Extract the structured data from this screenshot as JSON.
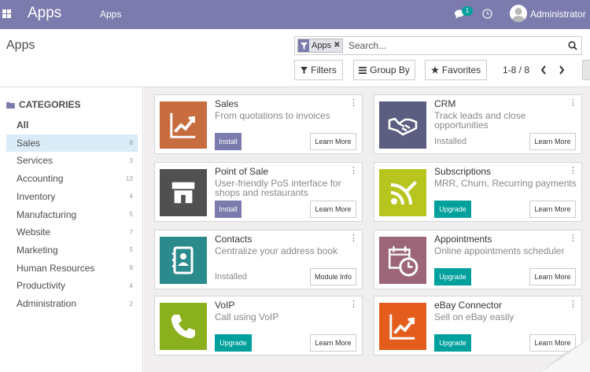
{
  "navbar": {
    "brand": "Apps",
    "menu": "Apps",
    "chat_badge": "1",
    "user": "Administrator",
    "bg_color": "#7c7bad"
  },
  "control": {
    "breadcrumb": "Apps",
    "facet_label": "Apps",
    "facet_close": "✖",
    "search_placeholder": "Search...",
    "filters_label": "Filters",
    "groupby_label": "Group By",
    "favorites_label": "Favorites",
    "pager": "1-8 / 8"
  },
  "sidebar": {
    "title": "CATEGORIES",
    "items": [
      {
        "label": "All",
        "count": ""
      },
      {
        "label": "Sales",
        "count": "8"
      },
      {
        "label": "Services",
        "count": "3"
      },
      {
        "label": "Accounting",
        "count": "13"
      },
      {
        "label": "Inventory",
        "count": "4"
      },
      {
        "label": "Manufacturing",
        "count": "5"
      },
      {
        "label": "Website",
        "count": "7"
      },
      {
        "label": "Marketing",
        "count": "5"
      },
      {
        "label": "Human Resources",
        "count": "9"
      },
      {
        "label": "Productivity",
        "count": "4"
      },
      {
        "label": "Administration",
        "count": "2"
      }
    ]
  },
  "apps": [
    {
      "name": "Sales",
      "desc": "From quotations to invoices",
      "action": "Install",
      "secondary": "Learn More",
      "color": "#c76c3e",
      "icon": "chart-up-icon"
    },
    {
      "name": "CRM",
      "desc": "Track leads and close opportunities",
      "action": "Installed",
      "secondary": "Learn More",
      "color": "#5b5e80",
      "icon": "handshake-icon"
    },
    {
      "name": "Point of Sale",
      "desc": "User-friendly PoS interface for shops and restaurants",
      "action": "Install",
      "secondary": "Learn More",
      "color": "#505050",
      "icon": "store-icon"
    },
    {
      "name": "Subscriptions",
      "desc": "MRR, Churn, Recurring payments",
      "action": "Upgrade",
      "secondary": "Learn More",
      "color": "#b7c51e",
      "icon": "rss-pen-icon"
    },
    {
      "name": "Contacts",
      "desc": "Centralize your address book",
      "action": "Installed",
      "secondary": "Module Info",
      "color": "#2b8a8c",
      "icon": "address-book-icon"
    },
    {
      "name": "Appointments",
      "desc": "Online appointments scheduler",
      "action": "Upgrade",
      "secondary": "Learn More",
      "color": "#9c6578",
      "icon": "calendar-clock-icon"
    },
    {
      "name": "VoIP",
      "desc": "Call using VoIP",
      "action": "Upgrade",
      "secondary": "Learn More",
      "color": "#8ab01d",
      "icon": "phone-icon"
    },
    {
      "name": "eBay Connector",
      "desc": "Sell on eBay easily",
      "action": "Upgrade",
      "secondary": "Learn More",
      "color": "#e55d1c",
      "icon": "chart-up-icon"
    }
  ]
}
